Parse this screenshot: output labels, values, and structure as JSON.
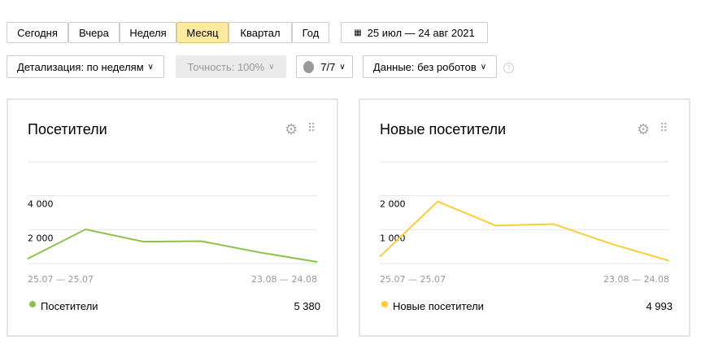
{
  "periods": [
    "Сегодня",
    "Вчера",
    "Неделя",
    "Месяц",
    "Квартал",
    "Год"
  ],
  "active_period": "Месяц",
  "date_range": "25 июл — 24 авг 2021",
  "detail": "Детализация: по неделям",
  "accuracy": "Точность: 100%",
  "segments": "7/7",
  "data_filter": "Данные: без роботов",
  "help": "?",
  "colors": {
    "visitors": "#8bc34a",
    "new_visitors": "#ffcc33"
  },
  "chart_data": [
    {
      "type": "line",
      "title": "Посетители",
      "series_name": "Посетители",
      "total": "5 380",
      "ylim": [
        0,
        6000
      ],
      "yticks": [
        {
          "v": 4000,
          "label": "4 000"
        },
        {
          "v": 2000,
          "label": "2 000"
        }
      ],
      "x_first": "25.07 — 25.07",
      "x_last": "23.08 — 24.08",
      "values": [
        280,
        2015,
        1290,
        1320,
        660,
        95
      ],
      "color": "#8bc34a"
    },
    {
      "type": "line",
      "title": "Новые посетители",
      "series_name": "Новые посетители",
      "total": "4 993",
      "ylim": [
        0,
        3000
      ],
      "yticks": [
        {
          "v": 2000,
          "label": "2 000"
        },
        {
          "v": 1000,
          "label": "1 000"
        }
      ],
      "x_first": "25.07 — 25.07",
      "x_last": "23.08 — 24.08",
      "values": [
        200,
        1830,
        1120,
        1165,
        580,
        80
      ],
      "color": "#ffcc33"
    }
  ]
}
